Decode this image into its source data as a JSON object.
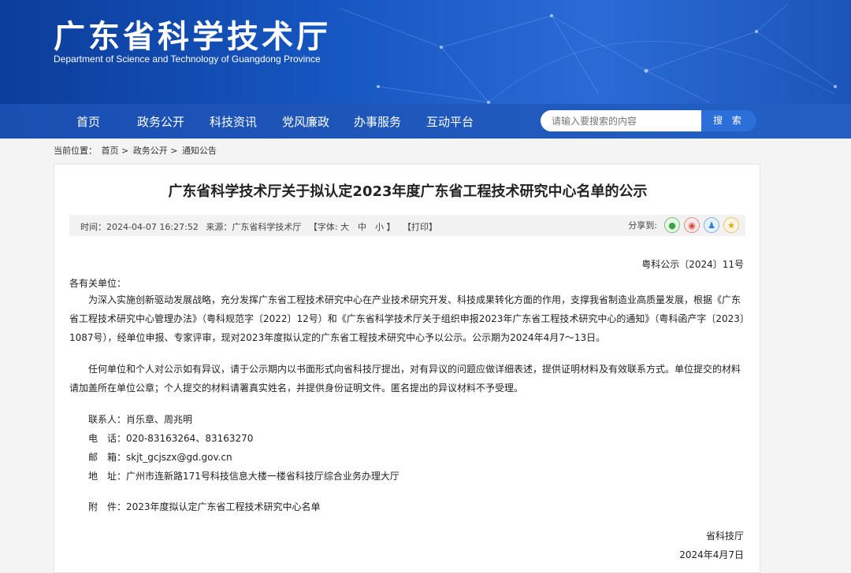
{
  "header": {
    "title": "广东省科学技术厅",
    "subtitle": "Department of Science and Technology of Guangdong Province"
  },
  "nav": {
    "items": [
      "首页",
      "政务公开",
      "科技资讯",
      "党风廉政",
      "办事服务",
      "互动平台"
    ],
    "search_placeholder": "请输入要搜索的内容",
    "search_button": "搜 索"
  },
  "breadcrumb": {
    "label": "当前位置：",
    "items": [
      "首页",
      "政务公开",
      "通知公告"
    ],
    "separator": ">"
  },
  "article": {
    "title": "广东省科学技术厅关于拟认定2023年度广东省工程技术研究中心名单的公示",
    "meta": {
      "time": "时间：2024-04-07 16:27:52",
      "source": "来源：广东省科学技术厅",
      "font": "【字体: 大　中　小 】",
      "print": "【打印】",
      "share_label": "分享到:"
    },
    "doc_number": "粤科公示〔2024〕11号",
    "salutation": "各有关单位：",
    "paragraphs": [
      "为深入实施创新驱动发展战略，充分发挥广东省工程技术研究中心在产业技术研究开发、科技成果转化方面的作用，支撑我省制造业高质量发展，根据《广东省工程技术研究中心管理办法》（粤科规范字〔2022〕12号）和《广东省科学技术厅关于组织申报2023年广东省工程技术研究中心的通知》（粤科函产字〔2023〕1087号），经单位申报、专家评审，现对2023年度拟认定的广东省工程技术研究中心予以公示。公示期为2024年4月7～13日。",
      "任何单位和个人对公示如有异议，请于公示期内以书面形式向省科技厅提出，对有异议的问题应做详细表述，提供证明材料及有效联系方式。单位提交的材料请加盖所在单位公章；个人提交的材料请署真实姓名，并提供身份证明文件。匿名提出的异议材料不予受理。"
    ],
    "contacts": [
      {
        "label": "联系人：",
        "value": "肖乐章、周兆明"
      },
      {
        "label": "电　话：",
        "value": "020-83163264、83163270"
      },
      {
        "label": "邮　箱：",
        "value": "skjt_gcjszx@gd.gov.cn"
      },
      {
        "label": "地　址：",
        "value": "广州市连新路171号科技信息大楼一楼省科技厅综合业务办理大厅"
      }
    ],
    "attachment": {
      "label": "附　件：",
      "value": "2023年度拟认定广东省工程技术研究中心名单"
    },
    "signoff_org": "省科技厅",
    "signoff_date": "2024年4月7日"
  },
  "share_icons": [
    "wechat-icon",
    "weibo-icon",
    "qq-icon",
    "qzone-icon"
  ]
}
